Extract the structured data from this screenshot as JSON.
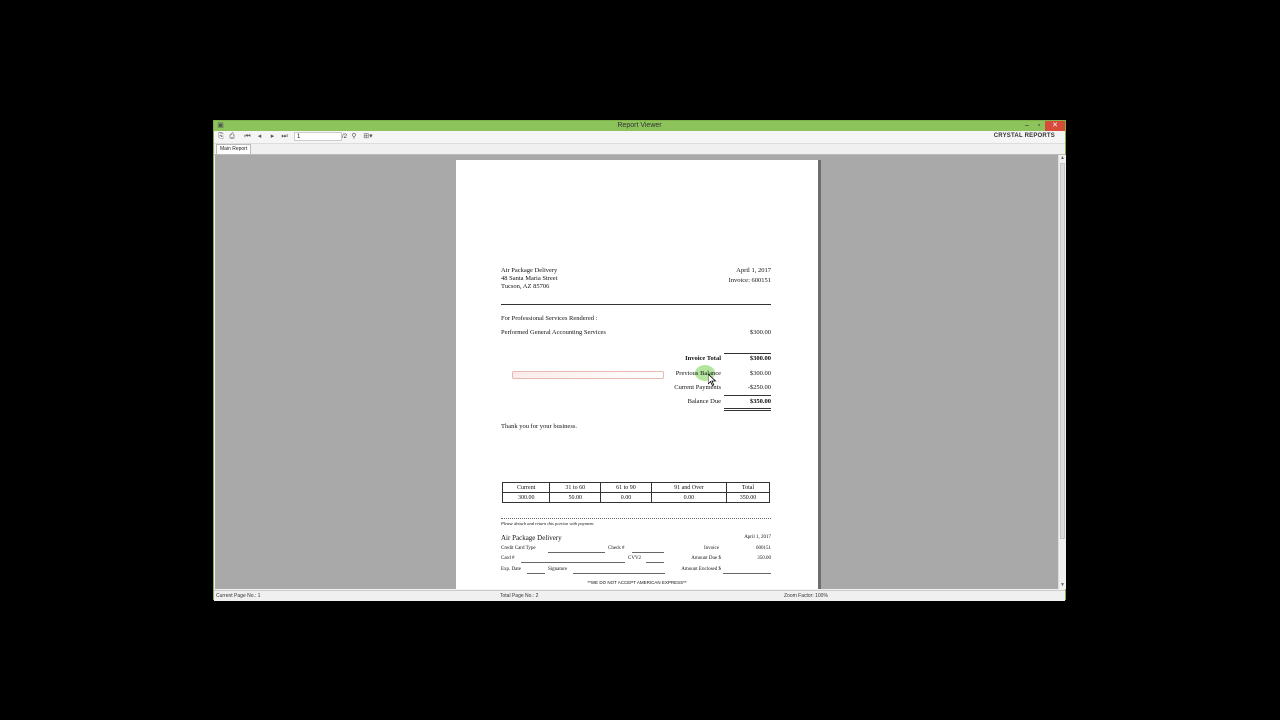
{
  "window": {
    "title": "Report Viewer",
    "controls": {
      "minimize": "–",
      "maximize": "▫",
      "close": "✕"
    }
  },
  "toolbar": {
    "page_input": "1",
    "page_total": "/2",
    "brand": "CRYSTAL REPORTS"
  },
  "tabs": [
    {
      "label": "Main Report"
    }
  ],
  "statusbar": {
    "current_page": "Current Page No.: 1",
    "total_page": "Total Page No.: 2",
    "zoom": "Zoom Factor: 100%"
  },
  "invoice": {
    "company": {
      "name": "Air Package Delivery",
      "street": "48 Santa Maria Street",
      "city": "Tucson, AZ 85706"
    },
    "date": "April 1, 2017",
    "invoice_no": "Invoice: 600151",
    "services_heading": "For Professional Services Rendered :",
    "line_item": {
      "description": "Performed General Accounting Services",
      "amount": "$300.00"
    },
    "totals": {
      "invoice_total_label": "Invoice Total",
      "invoice_total": "$300.00",
      "previous_balance_label": "Previous Balance",
      "previous_balance": "$300.00",
      "current_payments_label": "Current Payments",
      "current_payments": "-$250.00",
      "balance_due_label": "Balance Due",
      "balance_due": "$350.00"
    },
    "thanks": "Thank you for your business.",
    "aging": {
      "headers": [
        "Current",
        "31 to 60",
        "61 to 90",
        "91 and Over",
        "Total"
      ],
      "values": [
        "300.00",
        "50.00",
        "0.00",
        "0.00",
        "350.00"
      ]
    },
    "remit": {
      "detach_note": "Please detach and return this portion with payment.",
      "company": "Air Package Delivery",
      "date": "April 1, 2017",
      "credit_card_type": "Credit Card Type",
      "check_no": "Check #",
      "invoice_label": "Invoice",
      "invoice_value": "600151",
      "card_no": "Card #",
      "cvv2": "CVV2",
      "amount_due_label": "Amount Due $",
      "amount_due_value": "350.00",
      "exp_date": "Exp. Date",
      "signature": "Signature",
      "amount_enclosed": "Amount Enclosed $",
      "footer": "**WE DO NOT ACCEPT AMERICAN EXPRESS**"
    }
  },
  "colors": {
    "titlebar": "#8cc35a",
    "close": "#d64b3a",
    "viewport": "#a9a9a9",
    "hover": "#78d250"
  }
}
